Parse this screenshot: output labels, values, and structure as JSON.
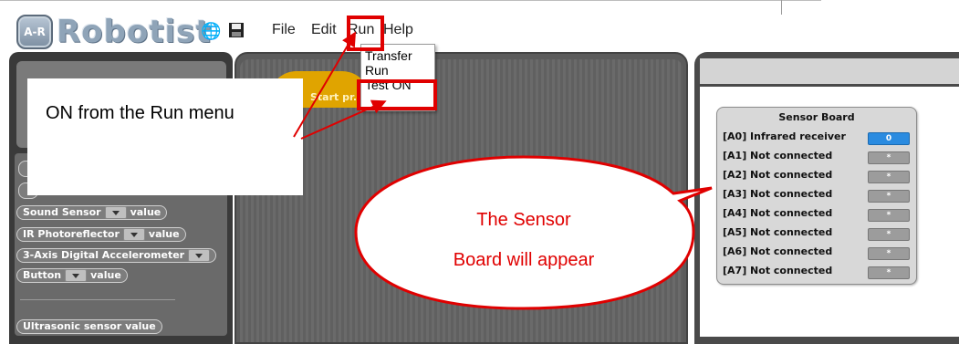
{
  "app": {
    "logo_badge": "A-R",
    "logo_text": "Robotist"
  },
  "toolbar": {
    "globe_icon": "globe-icon",
    "save_icon": "floppy-disk-icon"
  },
  "menu": {
    "file": "File",
    "edit": "Edit",
    "run": "Run",
    "help": "Help"
  },
  "run_menu": {
    "items": [
      "Transfer",
      "Run",
      "Test ON"
    ]
  },
  "editor": {
    "start_block": "Start pr..."
  },
  "blocks": {
    "sound_sensor": "Sound Sensor",
    "value": "value",
    "ir": "IR Photoreflector",
    "accel": "3-Axis Digital Accelerometer",
    "button": "Button",
    "ultrasonic": "Ultrasonic sensor value"
  },
  "annotation": {
    "instruction": "ON from the Run menu",
    "bubble_line1": "The Sensor",
    "bubble_line2": "Board will appear"
  },
  "sensor_board": {
    "title": "Sensor Board",
    "rows": [
      {
        "port": "[A0] Infrared receiver",
        "value": "0",
        "active": true
      },
      {
        "port": "[A1] Not connected",
        "value": "*"
      },
      {
        "port": "[A2] Not connected",
        "value": "*"
      },
      {
        "port": "[A3] Not connected",
        "value": "*"
      },
      {
        "port": "[A4] Not connected",
        "value": "*"
      },
      {
        "port": "[A5] Not connected",
        "value": "*"
      },
      {
        "port": "[A6] Not connected",
        "value": "*"
      },
      {
        "port": "[A7] Not connected",
        "value": "*"
      }
    ]
  },
  "colors": {
    "highlight": "#e00000",
    "active_value": "#2a8be0",
    "start_block": "#e0a400"
  }
}
